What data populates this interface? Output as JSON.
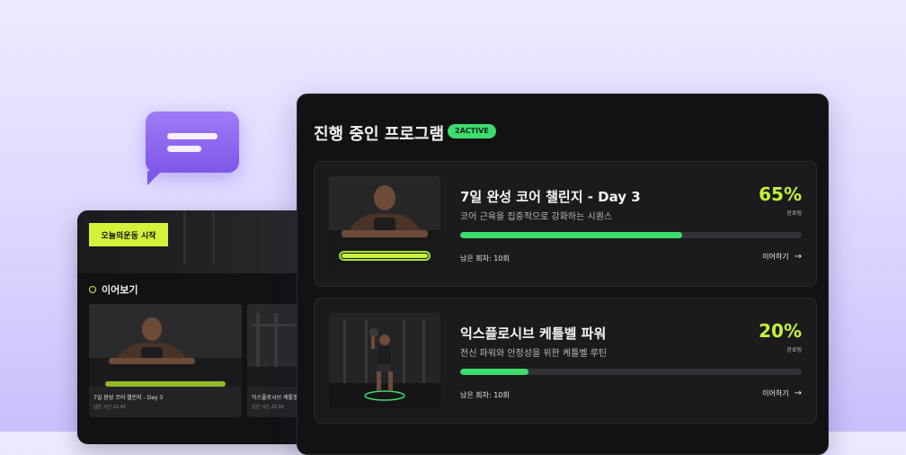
{
  "phone": {
    "start_button": "오늘의운동 시작",
    "section_title": "이어보기",
    "cards": [
      {
        "title": "7일 완성 코어 챌린지 - Day 3",
        "meta": "남은 시간 12:45"
      },
      {
        "title": "익스플로시브 케틀벨",
        "meta": "남은 시간 25:00"
      }
    ]
  },
  "panel": {
    "title": "진행 중인 프로그램",
    "badge": "2ACTIVE",
    "programs": [
      {
        "title": "7일 완성 코어 챌린지 - Day 3",
        "description": "코어 근육을 집중적으로 강화하는 시퀀스",
        "percent_text": "65%",
        "progress": 0.65,
        "percent_label": "완료됨",
        "remaining": "남은 회차: 10회",
        "continue_label": "이어하기"
      },
      {
        "title": "익스플로시브 케틀벨 파워",
        "description": "전신 파워와 안정성을 위한 케틀벨 루틴",
        "percent_text": "20%",
        "progress": 0.2,
        "percent_label": "완료됨",
        "remaining": "남은 회차: 10회",
        "continue_label": "이어하기"
      }
    ]
  },
  "icons": {
    "chat": "chat-bubble-icon",
    "continue": "arrow-right-icon",
    "section": "ring-dot-icon"
  },
  "colors": {
    "accent_lime": "#d6f13a",
    "progress_green": "#3ddc6d",
    "percent_lime": "#c4f23a",
    "panel_bg": "#121214",
    "chat_purple": "#8f67f0"
  }
}
